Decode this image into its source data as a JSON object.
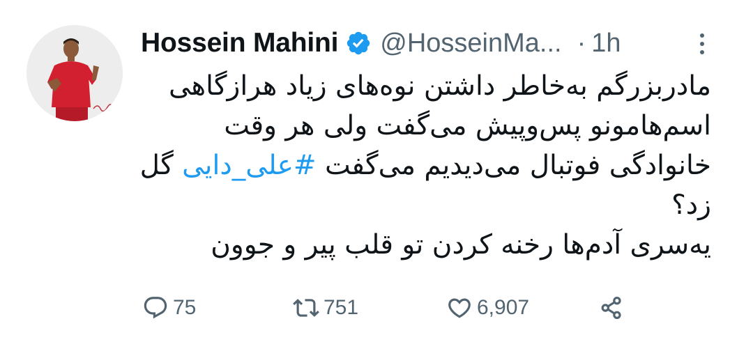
{
  "author": {
    "display_name": "Hossein Mahini",
    "handle": "@HosseinMa...",
    "separator": "·",
    "time": "1h",
    "verified_icon": "verified-badge-icon"
  },
  "tweet": {
    "line1": "مادربزرگم به‌خاطر داشتن نوه‌های زیاد هرازگاهی",
    "line2": "اسم‌هامونو پس‌وپیش می‌گفت ولی هر وقت",
    "line3_text": "خانوادگی فوتبال می‌دیدیم می‌گفت",
    "hashtag": "#علی_دایی",
    "line3_end": "گل",
    "line4": "زد؟",
    "line5": "یه‌سری آدم‌ها رخنه کردن تو قلب پیر و جوون"
  },
  "actions": {
    "replies": "75",
    "retweets": "751",
    "likes": "6,907",
    "reply_icon": "reply-icon",
    "retweet_icon": "retweet-icon",
    "like_icon": "heart-icon",
    "share_icon": "share-icon"
  },
  "colors": {
    "text": "#0f1419",
    "secondary": "#536471",
    "accent": "#1d9bf0",
    "jersey": "#d22030"
  }
}
